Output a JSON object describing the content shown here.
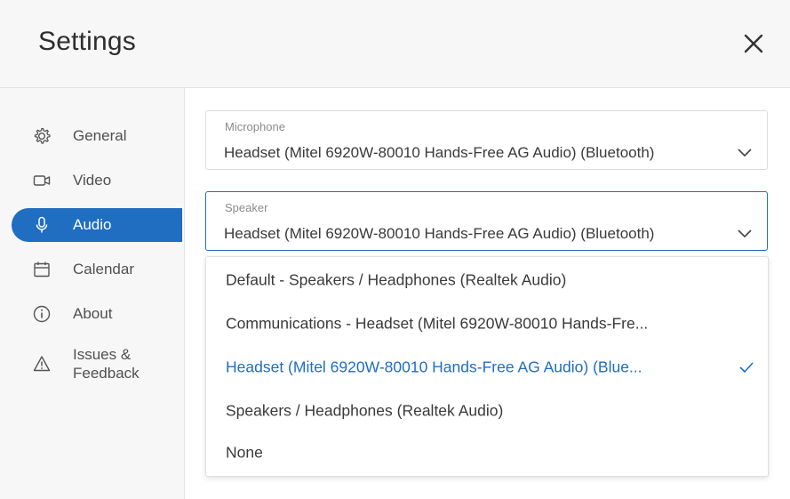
{
  "header": {
    "title": "Settings",
    "close_icon": "close-icon"
  },
  "sidebar": {
    "items": [
      {
        "label": "General",
        "icon": "gear-icon",
        "active": false
      },
      {
        "label": "Video",
        "icon": "video-camera-icon",
        "active": false
      },
      {
        "label": "Audio",
        "icon": "microphone-icon",
        "active": true
      },
      {
        "label": "Calendar",
        "icon": "calendar-icon",
        "active": false
      },
      {
        "label": "About",
        "icon": "info-icon",
        "active": false
      },
      {
        "label": "Issues &",
        "label2": "Feedback",
        "icon": "warning-icon",
        "active": false
      }
    ]
  },
  "audio": {
    "microphone": {
      "label": "Microphone",
      "value": "Headset (Mitel 6920W-80010 Hands-Free AG Audio) (Bluetooth)"
    },
    "speaker": {
      "label": "Speaker",
      "value": "Headset (Mitel 6920W-80010 Hands-Free AG Audio) (Bluetooth)",
      "options": [
        "Default - Speakers / Headphones (Realtek Audio)",
        "Communications - Headset (Mitel 6920W-80010 Hands-Fre...",
        "Headset (Mitel 6920W-80010 Hands-Free AG Audio) (Blue...",
        "Speakers / Headphones (Realtek Audio)",
        "None"
      ],
      "selected_option": "Headset (Mitel 6920W-80010 Hands-Free AG Audio) (Blue..."
    }
  },
  "colors": {
    "accent": "#1f6ec1",
    "panel_bg": "#f7f7f8"
  }
}
